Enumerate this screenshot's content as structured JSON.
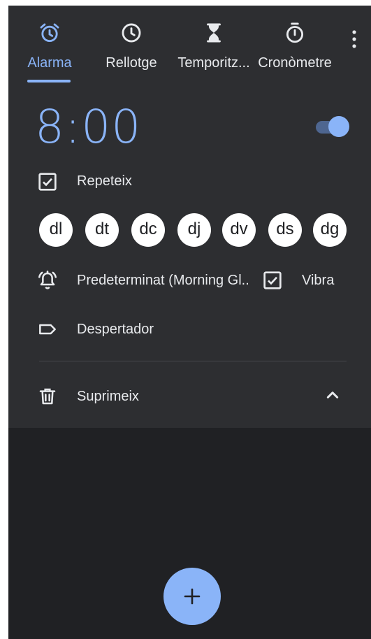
{
  "tabs": [
    {
      "label": "Alarma",
      "icon": "alarm-icon",
      "active": true
    },
    {
      "label": "Rellotge",
      "icon": "clock-icon",
      "active": false
    },
    {
      "label": "Temporitz...",
      "icon": "hourglass-icon",
      "active": false
    },
    {
      "label": "Cronòmetre",
      "icon": "stopwatch-icon",
      "active": false
    }
  ],
  "alarm": {
    "time": "8:00",
    "enabled": true,
    "repeat_label": "Repeteix",
    "repeat_checked": true,
    "days": [
      "dl",
      "dt",
      "dc",
      "dj",
      "dv",
      "ds",
      "dg"
    ],
    "ringtone_label": "Predeterminat (Morning Gl..",
    "vibrate_label": "Vibra",
    "vibrate_checked": true,
    "alarm_label": "Despertador",
    "delete_label": "Suprimeix"
  },
  "colors": {
    "accent": "#8ab4f8",
    "background": "#202124",
    "card": "#2d2e31",
    "text": "#e8eaed"
  },
  "fab": {
    "icon": "plus-icon"
  }
}
